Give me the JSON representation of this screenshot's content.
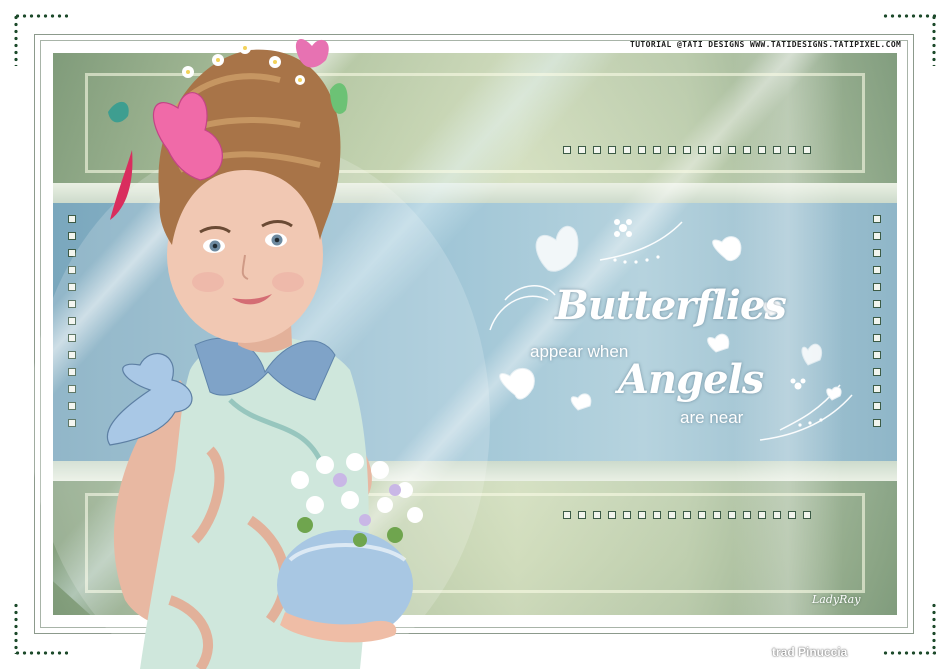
{
  "credit": {
    "text": "TUTORIAL @TATI DESIGNS WWW.TATIDESIGNS.TATIPIXEL.COM"
  },
  "quote": {
    "line1": "Butterflies",
    "line2": "appear when",
    "line3": "Angels",
    "line4": "are near"
  },
  "signature": {
    "text": "LadyRay"
  },
  "translator": {
    "text": "trad Pinuccia"
  },
  "icons": [
    "butterfly-icon",
    "flower-icon",
    "dotted-corner-bracket"
  ],
  "colors": {
    "frame_dark": "#1d4a2b",
    "sage": "#a9bd9e",
    "sky": "#9cc1d3",
    "pink_butterfly": "#f06aa8"
  }
}
